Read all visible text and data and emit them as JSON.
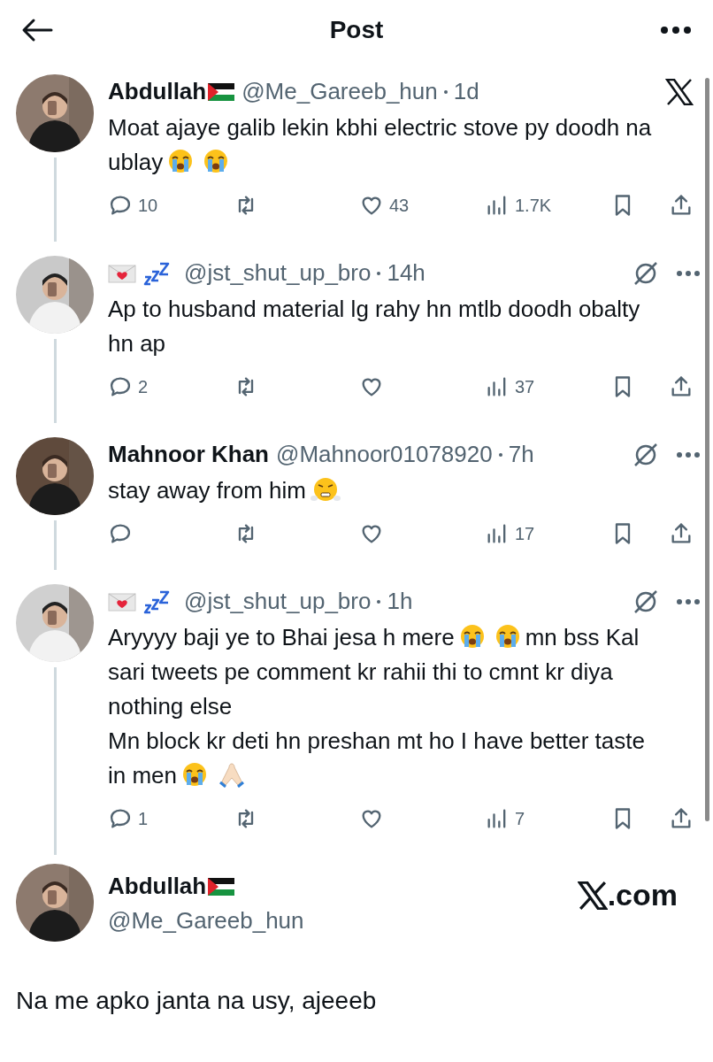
{
  "header": {
    "title": "Post"
  },
  "tweets": [
    {
      "name": "Abdullah",
      "badges": [
        {
          "kind": "flag"
        }
      ],
      "handle": "@Me_Gareeb_hun",
      "time": "1d",
      "corner": {
        "kind": "xlogo"
      },
      "body": [
        {
          "kind": "text",
          "text": "Moat ajaye galib lekin kbhi electric stove py doodh na ublay"
        },
        {
          "kind": "crying"
        },
        {
          "kind": "crying"
        }
      ],
      "actions": {
        "replies": "10",
        "likes": "43",
        "views": "1.7K"
      }
    },
    {
      "badges": [
        {
          "kind": "envelope"
        },
        {
          "kind": "zzz"
        }
      ],
      "handle": "@jst_shut_up_bro",
      "time": "14h",
      "corner": {
        "kind": "grok"
      },
      "body": [
        {
          "kind": "text",
          "text": "Ap to husband material lg rahy hn mtlb doodh obalty hn ap"
        }
      ],
      "actions": {
        "replies": "2",
        "views": "37"
      }
    },
    {
      "name": "Mahnoor Khan",
      "handle": "@Mahnoor01078920",
      "time": "7h",
      "corner": {
        "kind": "grok"
      },
      "body": [
        {
          "kind": "text",
          "text": "stay away from him"
        },
        {
          "kind": "steam"
        }
      ],
      "actions": {
        "views": "17"
      }
    },
    {
      "badges": [
        {
          "kind": "envelope"
        },
        {
          "kind": "zzz"
        }
      ],
      "handle": "@jst_shut_up_bro",
      "time": "1h",
      "corner": {
        "kind": "grok"
      },
      "body": [
        {
          "kind": "text",
          "text": "Aryyyy baji ye to Bhai jesa h mere"
        },
        {
          "kind": "crying"
        },
        {
          "kind": "crying"
        },
        {
          "kind": "text",
          "text": "mn bss Kal sari tweets pe comment kr rahii thi to cmnt kr diya nothing else\nMn block kr deti hn preshan mt ho I have better taste in men"
        },
        {
          "kind": "crying"
        },
        {
          "kind": "pray"
        }
      ],
      "actions": {
        "replies": "1",
        "views": "7"
      }
    }
  ],
  "main_post": {
    "name": "Abdullah",
    "badges": [
      {
        "kind": "flag"
      }
    ],
    "handle": "@Me_Gareeb_hun",
    "brand": ".com",
    "text": "Na me apko janta na usy, ajeeeb"
  }
}
